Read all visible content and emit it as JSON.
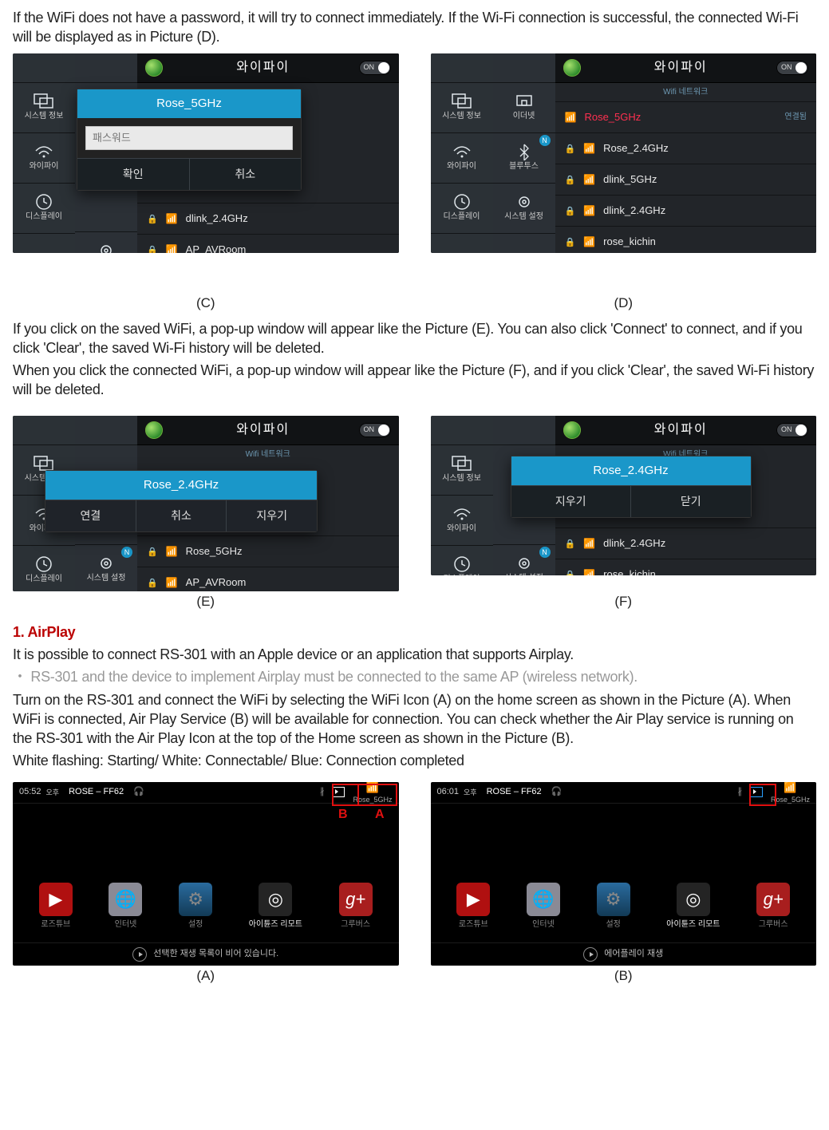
{
  "intro": "If the WiFi does not have a password, it will try to connect immediately. If the Wi-Fi connection is successful, the connected Wi-Fi will be displayed as in Picture (D).",
  "caps": {
    "c": "(C)",
    "d": "(D)",
    "e": "(E)",
    "f": "(F)",
    "a": "(A)",
    "b": "(B)"
  },
  "mid1": "If you click on the saved WiFi, a pop-up window will appear like the Picture (E). You can also click 'Connect' to connect, and if you click 'Clear', the saved Wi-Fi history will be deleted.",
  "mid2": "When you click the connected WiFi, a pop-up window will appear like the Picture (F), and if you click 'Clear', the saved Wi-Fi history will be deleted.",
  "airplay": {
    "head": "1. AirPlay",
    "p1": "It is possible to connect RS-301 with an Apple device or an application that supports Airplay.",
    "note": "RS-301 and the device to implement Airplay must be connected to the same AP (wireless network).",
    "p2": "Turn on the RS-301 and connect the WiFi by selecting the WiFi Icon (A) on the home screen as shown in the Picture (A). When WiFi is connected, Air Play Service (B) will be available for connection. You can check whether the Air Play service is running on the RS-301 with the Air Play Icon at the top of the Home screen as shown in the Picture (B).",
    "p3": "White flashing: Starting/ White: Connectable/ Blue: Connection completed"
  },
  "ui": {
    "header": {
      "title": "와이파이",
      "on": "ON",
      "sub": "Wifi 네트워크"
    },
    "side": {
      "sys": "시스템 정보",
      "wifi": "와이파이",
      "display": "디스플레이",
      "settings": "시스템 설정",
      "ethernet": "이더넷",
      "bluetooth": "블루투스"
    },
    "nets": {
      "rose5": "Rose_5GHz",
      "rose24": "Rose_2.4GHz",
      "dlink5": "dlink_5GHz",
      "dlink24": "dlink_2.4GHz",
      "kichin": "rose_kichin",
      "avroom": "AP_AVRoom"
    },
    "popupC": {
      "title": "Rose_5GHz",
      "placeholder": "패스워드",
      "ok": "확인",
      "cancel": "취소"
    },
    "popupE": {
      "title": "Rose_2.4GHz",
      "connect": "연결",
      "cancel": "취소",
      "clear": "지우기"
    },
    "popupF": {
      "title": "Rose_2.4GHz",
      "clear": "지우기",
      "close": "닫기"
    }
  },
  "home": {
    "a": {
      "time": "05:52",
      "ampm": "오후",
      "device": "ROSE – FF62",
      "wifilab": "Rose_5GHz",
      "foot": "선택한 재생 목록이 비어 있습니다."
    },
    "b": {
      "time": "06:01",
      "ampm": "오후",
      "device": "ROSE – FF62",
      "wifilab": "Rose_5GHz",
      "foot": "에어플레이 재생"
    },
    "apps": {
      "rosetube": "로즈튜브",
      "internet": "인터넷",
      "settings": "설정",
      "remote": "아이튠즈 리모트",
      "groovers": "그루버스"
    },
    "letters": {
      "a": "A",
      "b": "B",
      "n": "N"
    }
  }
}
